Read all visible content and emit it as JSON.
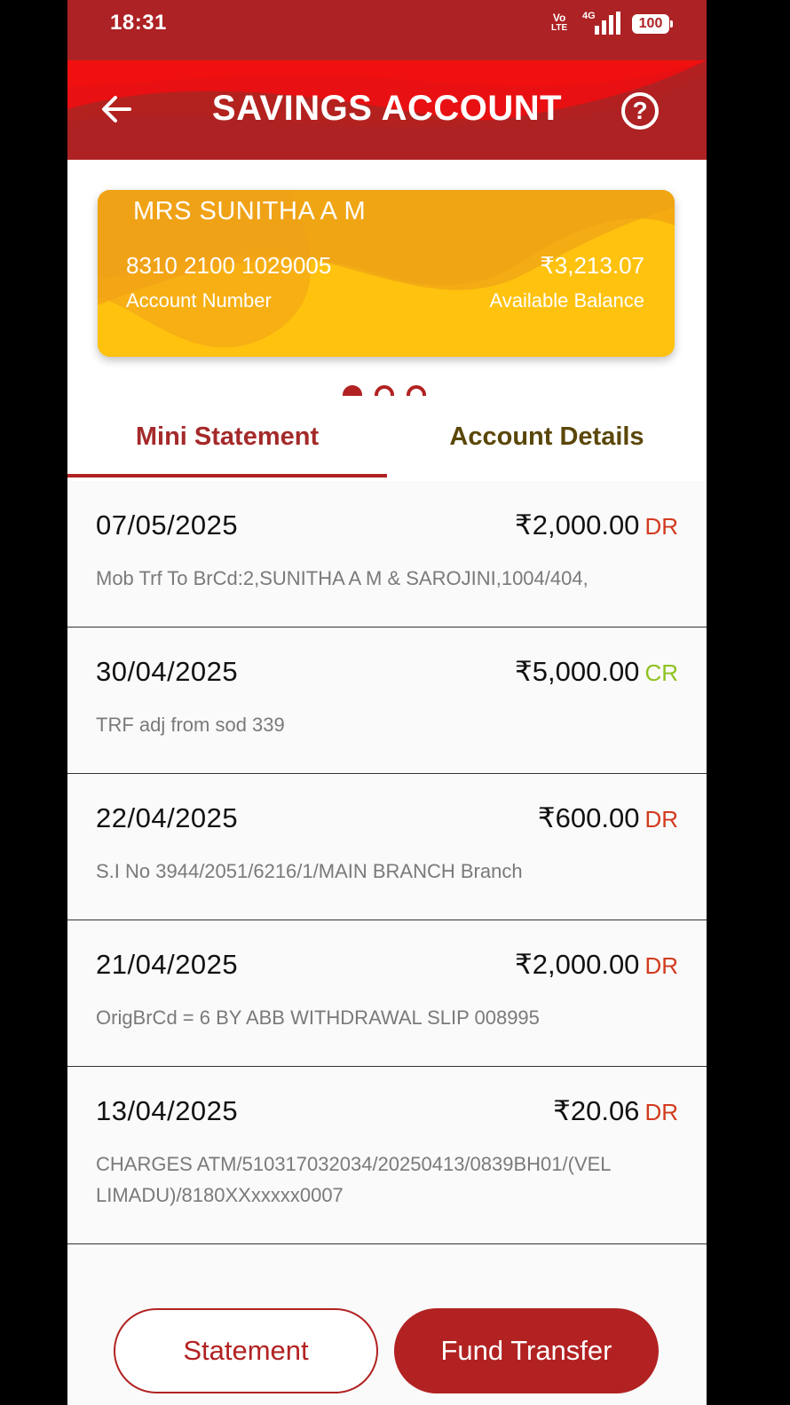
{
  "status_bar": {
    "time": "18:31",
    "volte_top": "Vo",
    "volte_bottom": "LTE",
    "network": "4G",
    "battery": "100"
  },
  "header": {
    "title": "SAVINGS ACCOUNT",
    "help": "?"
  },
  "account_card": {
    "holder_name": "MRS SUNITHA A M",
    "account_number": "8310 2100 1029005",
    "account_number_label": "Account Number",
    "balance": "₹3,213.07",
    "balance_label": "Available Balance",
    "pager_dots": 3,
    "active_dot": 1
  },
  "tabs": [
    {
      "label": "Mini Statement",
      "active": true
    },
    {
      "label": "Account Details",
      "active": false
    }
  ],
  "transactions": [
    {
      "date": "07/05/2025",
      "amount": "₹2,000.00",
      "type": "DR",
      "description": "Mob Trf To BrCd:2,SUNITHA A M & SAROJINI,1004/404,"
    },
    {
      "date": "30/04/2025",
      "amount": "₹5,000.00",
      "type": "CR",
      "description": "TRF adj from sod 339"
    },
    {
      "date": "22/04/2025",
      "amount": "₹600.00",
      "type": "DR",
      "description": "S.I No 3944/2051/6216/1/MAIN BRANCH Branch"
    },
    {
      "date": "21/04/2025",
      "amount": "₹2,000.00",
      "type": "DR",
      "description": "OrigBrCd = 6 BY ABB WITHDRAWAL SLIP  008995"
    },
    {
      "date": "13/04/2025",
      "amount": "₹20.06",
      "type": "DR",
      "description": "CHARGES ATM/510317032034/20250413/0839BH01/(VELLIMADU)/8180XXxxxxx0007"
    }
  ],
  "buttons": {
    "statement": "Statement",
    "fund_transfer": "Fund Transfer"
  },
  "colors": {
    "brand_red": "#b22222",
    "card_yellow": "#ffc20e",
    "debit": "#d23a1e",
    "credit": "#8dc21f"
  }
}
